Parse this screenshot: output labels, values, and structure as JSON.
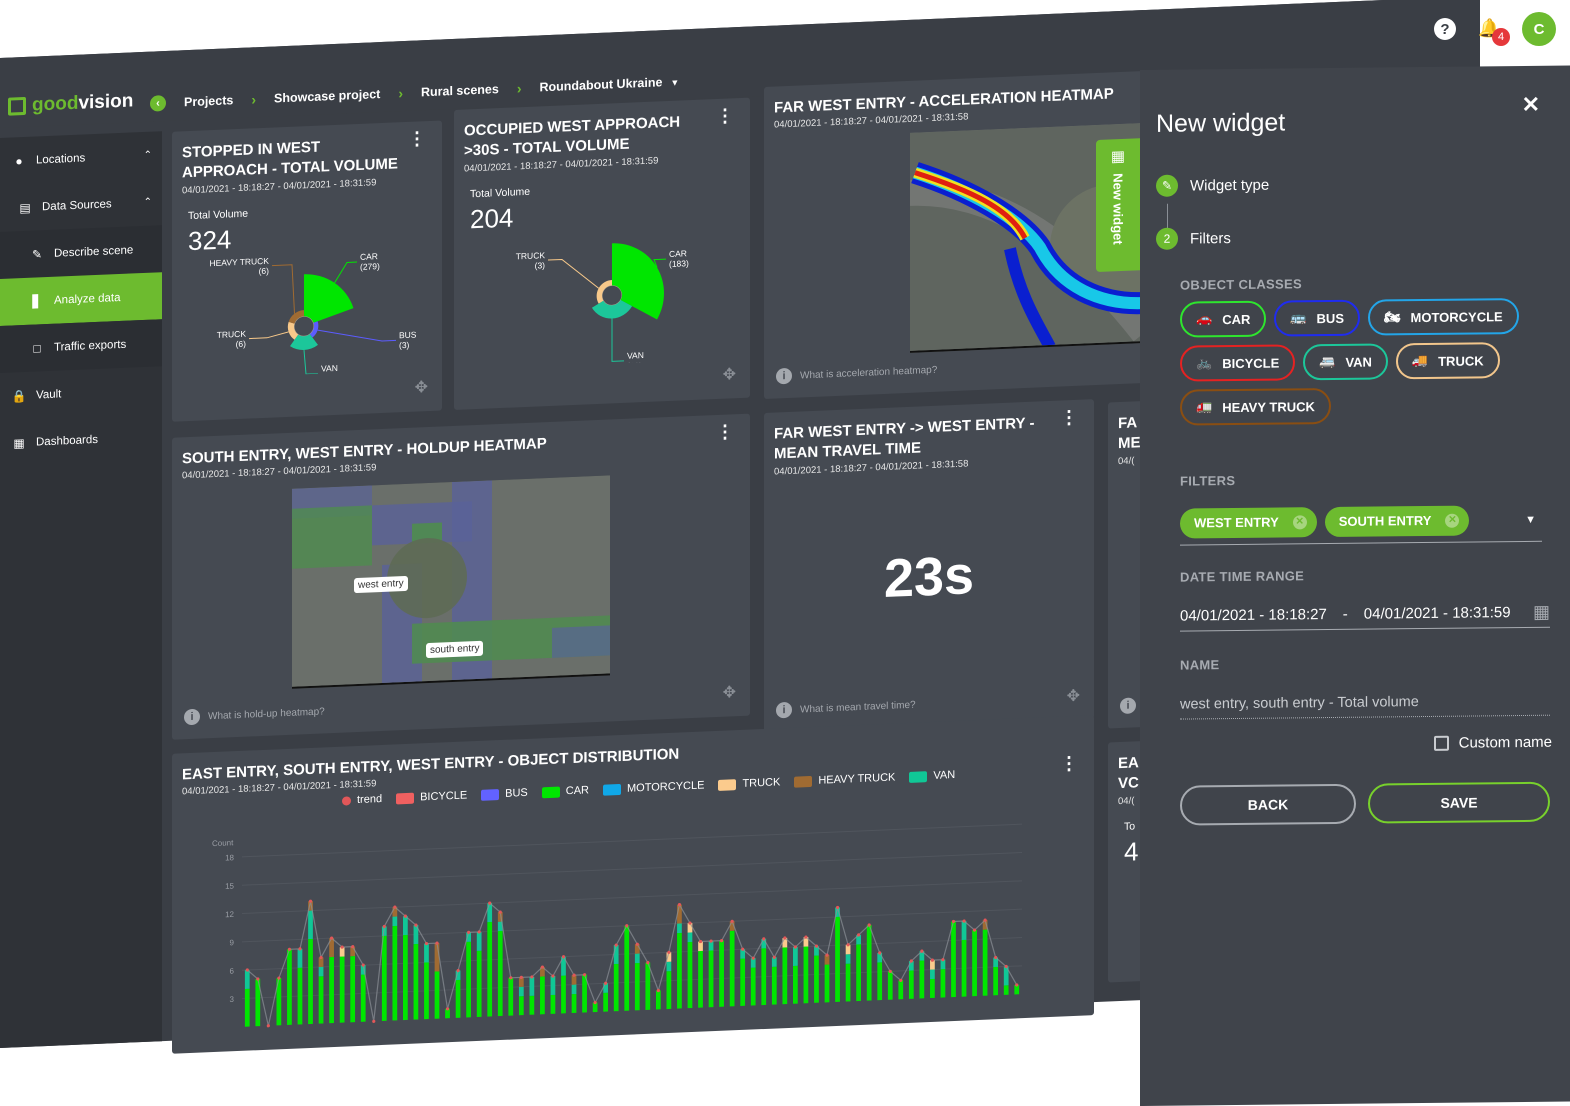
{
  "topbar": {
    "help_label": "?",
    "notifications_count": "4",
    "avatar_initial": "C"
  },
  "brand": {
    "name_prefix": "good",
    "name_suffix": "vision"
  },
  "breadcrumb": {
    "items": [
      "Projects",
      "Showcase project",
      "Rural scenes",
      "Roundabout Ukraine"
    ]
  },
  "sidebar": {
    "items": [
      {
        "label": "Locations",
        "icon": "map-pin-icon"
      },
      {
        "label": "Data Sources",
        "icon": "data-sources-icon"
      },
      {
        "label": "Describe scene",
        "icon": "pencil-icon"
      },
      {
        "label": "Analyze data",
        "icon": "bar-chart-icon",
        "active": true
      },
      {
        "label": "Traffic exports",
        "icon": "file-icon"
      },
      {
        "label": "Vault",
        "icon": "lock-icon"
      },
      {
        "label": "Dashboards",
        "icon": "dashboard-icon"
      }
    ]
  },
  "widgets": {
    "stopped": {
      "title": "STOPPED IN WEST APPROACH - TOTAL VOLUME",
      "date": "04/01/2021 - 18:18:27 - 04/01/2021 - 18:31:59",
      "volume_label": "Total Volume",
      "volume_value": "324",
      "slices": [
        {
          "name": "CAR",
          "value": 279,
          "label": "CAR",
          "count": "(279)",
          "color": "#00e600"
        },
        {
          "name": "BUS",
          "value": 3,
          "label": "BUS",
          "count": "(3)",
          "color": "#5c5cff"
        },
        {
          "name": "VAN",
          "value": 30,
          "label": "VAN",
          "count": "(30)",
          "color": "#1cc79a"
        },
        {
          "name": "TRUCK",
          "value": 6,
          "label": "TRUCK",
          "count": "(6)",
          "color": "#f8c98a"
        },
        {
          "name": "HEAVY TRUCK",
          "value": 6,
          "label": "HEAVY TRUCK",
          "count": "(6)",
          "color": "#a06b32"
        }
      ]
    },
    "occupied": {
      "title": "OCCUPIED WEST APPROACH >30S - TOTAL VOLUME",
      "date": "04/01/2021 - 18:18:27 - 04/01/2021 - 18:31:59",
      "volume_label": "Total Volume",
      "volume_value": "204",
      "slices": [
        {
          "name": "CAR",
          "value": 183,
          "label": "CAR",
          "count": "(183)",
          "color": "#00e600"
        },
        {
          "name": "VAN",
          "value": 18,
          "label": "VAN",
          "count": "(18)",
          "color": "#1cc79a"
        },
        {
          "name": "TRUCK",
          "value": 3,
          "label": "TRUCK",
          "count": "(3)",
          "color": "#f8c98a"
        }
      ]
    },
    "accel": {
      "title": "FAR WEST ENTRY - ACCELERATION HEATMAP",
      "date": "04/01/2021 - 18:18:27 - 04/01/2021 - 18:31:58",
      "info": "What is acceleration heatmap?"
    },
    "holdup": {
      "title": "SOUTH ENTRY, WEST ENTRY - HOLDUP HEATMAP",
      "date": "04/01/2021 - 18:18:27 - 04/01/2021 - 18:31:59",
      "label_west": "west entry",
      "label_south": "south entry",
      "info": "What is hold-up heatmap?"
    },
    "travel": {
      "title": "FAR WEST ENTRY -> WEST ENTRY - MEAN TRAVEL TIME",
      "date": "04/01/2021 - 18:18:27 - 04/01/2021 - 18:31:58",
      "value": "23s",
      "info": "What is mean travel time?"
    },
    "partial_right_1": {
      "title_a": "FA",
      "title_b": "ME",
      "date": "04/("
    },
    "partial_right_2": {
      "title_a": "EA",
      "title_b": "VC",
      "date": "04/(",
      "vol_label": "To",
      "vol_value": "4"
    },
    "distribution": {
      "title": "EAST ENTRY, SOUTH ENTRY, WEST ENTRY - OBJECT DISTRIBUTION",
      "date": "04/01/2021 - 18:18:27 - 04/01/2021 - 18:31:59"
    }
  },
  "new_widget_tab": {
    "label": "New widget"
  },
  "panel": {
    "title": "New widget",
    "steps": [
      {
        "label": "Widget type",
        "marker": "✎"
      },
      {
        "label": "Filters",
        "marker": "2"
      }
    ],
    "object_classes_label": "OBJECT CLASSES",
    "object_classes": [
      {
        "label": "CAR",
        "color": "#2ee52e",
        "icon": "🚗"
      },
      {
        "label": "BUS",
        "color": "#1f2cf0",
        "icon": "🚌"
      },
      {
        "label": "MOTORCYCLE",
        "color": "#23a5e8",
        "icon": "🏍"
      },
      {
        "label": "BICYCLE",
        "color": "#e52222",
        "icon": "🚲"
      },
      {
        "label": "VAN",
        "color": "#1cc79a",
        "icon": "🚐"
      },
      {
        "label": "TRUCK",
        "color": "#f2c68c",
        "icon": "🚚"
      },
      {
        "label": "HEAVY TRUCK",
        "color": "#8a4e12",
        "icon": "🚛"
      }
    ],
    "filters_label": "FILTERS",
    "filters": [
      "WEST ENTRY",
      "SOUTH ENTRY"
    ],
    "datetime_label": "DATE TIME RANGE",
    "date_from": "04/01/2021 - 18:18:27",
    "date_sep": "-",
    "date_to": "04/01/2021 - 18:31:59",
    "name_label": "NAME",
    "name_value": "west entry, south entry - Total volume",
    "custom_name_label": "Custom name",
    "custom_name_checked": false,
    "back_label": "BACK",
    "save_label": "SAVE"
  },
  "chart_data": {
    "type": "bar",
    "title": "EAST ENTRY, SOUTH ENTRY, WEST ENTRY - OBJECT DISTRIBUTION",
    "xlabel": "",
    "ylabel": "Count",
    "ylim": [
      0,
      18
    ],
    "yticks": [
      3,
      6,
      9,
      12,
      15,
      18
    ],
    "grid": true,
    "legend_position": "top",
    "legend": [
      {
        "name": "trend",
        "color": "#e15759",
        "kind": "line"
      },
      {
        "name": "BICYCLE",
        "color": "#f06060"
      },
      {
        "name": "BUS",
        "color": "#6262ff"
      },
      {
        "name": "CAR",
        "color": "#00e600"
      },
      {
        "name": "MOTORCYCLE",
        "color": "#10a8e8"
      },
      {
        "name": "TRUCK",
        "color": "#fbcb8d"
      },
      {
        "name": "HEAVY TRUCK",
        "color": "#a06b32"
      },
      {
        "name": "VAN",
        "color": "#10c796"
      }
    ],
    "series": [
      {
        "name": "CAR",
        "values": [
          4,
          5,
          0,
          5,
          8,
          6,
          9,
          5,
          7,
          7,
          7,
          5,
          0,
          9,
          10,
          9,
          8,
          6,
          5,
          1,
          4,
          8,
          7,
          10,
          9,
          4,
          2,
          2,
          4,
          2,
          4,
          2,
          4,
          1,
          2,
          5,
          9,
          5,
          5,
          2,
          4,
          8,
          7,
          6,
          6,
          7,
          8,
          5,
          4,
          6,
          4,
          6,
          4,
          6,
          5,
          4,
          9,
          4,
          6,
          8,
          4,
          3,
          2,
          3,
          4,
          2,
          3,
          8,
          6,
          7,
          7,
          3,
          1,
          1
        ]
      },
      {
        "name": "VAN",
        "values": [
          2,
          0,
          0,
          0,
          0,
          2,
          3,
          1,
          0,
          0,
          0,
          1,
          0,
          1,
          1,
          2,
          2,
          2,
          0,
          0,
          1,
          1,
          2,
          2,
          1,
          0,
          1,
          2,
          0,
          2,
          2,
          1,
          0,
          0,
          1,
          2,
          0,
          1,
          0,
          0,
          1,
          1,
          1,
          0,
          1,
          0,
          0,
          1,
          1,
          1,
          1,
          0,
          2,
          0,
          1,
          0,
          1,
          1,
          1,
          0,
          1,
          0,
          0,
          1,
          1,
          1,
          1,
          0,
          2,
          0,
          0,
          1,
          2,
          0
        ]
      },
      {
        "name": "HEAVY TRUCK",
        "values": [
          0,
          0,
          0,
          0,
          0,
          0,
          1,
          1,
          2,
          0,
          1,
          0,
          0,
          0,
          1,
          0,
          0,
          0,
          3,
          0,
          0,
          0,
          0,
          0,
          1,
          0,
          1,
          0,
          1,
          0,
          0,
          1,
          0,
          0,
          0,
          0,
          0,
          1,
          0,
          0,
          0,
          2,
          0,
          0,
          0,
          0,
          1,
          0,
          0,
          0,
          0,
          0,
          0,
          0,
          0,
          1,
          0,
          0,
          0,
          0,
          0,
          0,
          0,
          0,
          0,
          0,
          0,
          0,
          0,
          0,
          1,
          0,
          0,
          0
        ]
      },
      {
        "name": "TRUCK",
        "values": [
          0,
          0,
          0,
          0,
          0,
          0,
          0,
          0,
          0,
          1,
          0,
          0,
          0,
          0,
          0,
          0,
          0,
          0,
          0,
          0,
          0,
          0,
          0,
          0,
          0,
          0,
          0,
          0,
          0,
          0,
          0,
          0,
          0,
          0,
          0,
          0,
          0,
          0,
          0,
          0,
          1,
          0,
          1,
          1,
          0,
          0,
          0,
          0,
          0,
          0,
          0,
          1,
          0,
          1,
          0,
          0,
          0,
          1,
          0,
          0,
          0,
          0,
          0,
          0,
          0,
          1,
          0,
          0,
          0,
          0,
          0,
          0,
          0,
          0
        ]
      },
      {
        "name": "BICYCLE",
        "values": [
          0,
          0,
          0,
          0,
          0,
          0,
          0,
          0,
          0,
          0,
          0,
          0,
          0,
          0,
          0,
          0,
          0,
          0,
          0,
          0,
          0,
          0,
          0,
          0,
          0,
          0,
          0,
          0,
          0,
          0,
          0,
          0,
          0,
          0,
          0,
          0,
          0,
          0,
          0,
          0,
          0,
          0,
          0,
          0,
          0,
          0,
          0,
          0,
          0,
          0,
          0,
          0,
          0,
          0,
          0,
          0,
          0,
          0,
          0,
          0,
          0,
          0,
          0,
          0,
          0,
          0,
          0,
          0,
          0,
          0,
          0,
          0,
          0,
          0
        ]
      }
    ]
  }
}
